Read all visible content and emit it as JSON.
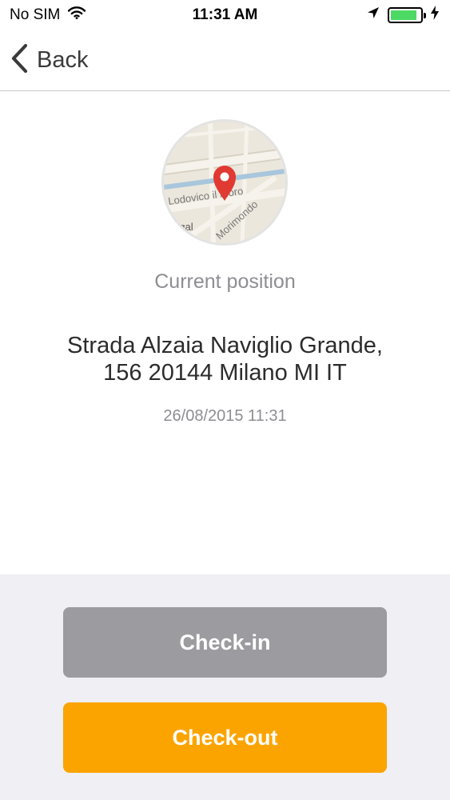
{
  "status_bar": {
    "carrier": "No SIM",
    "time": "11:31 AM",
    "battery_level": 0.9,
    "battery_color": "#4cd964"
  },
  "nav": {
    "back_label": "Back"
  },
  "map": {
    "street_labels": [
      "Lodovico il Moro",
      "Morimondo",
      "egal"
    ],
    "pin_color": "#e03a32"
  },
  "location": {
    "title": "Current position",
    "address_line1": "Strada Alzaia Naviglio Grande,",
    "address_line2": "156 20144 Milano MI IT",
    "timestamp": "26/08/2015 11:31"
  },
  "actions": {
    "checkin_label": "Check-in",
    "checkout_label": "Check-out",
    "checkin_color": "#9c9b9f",
    "checkout_color": "#fba400"
  }
}
